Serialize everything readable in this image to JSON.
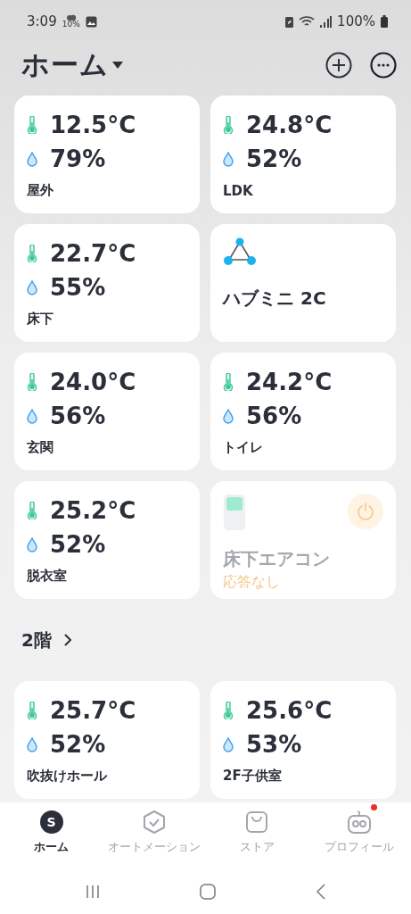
{
  "status_bar": {
    "time": "3:09",
    "weather_label": "10%",
    "battery": "100%"
  },
  "header": {
    "title": "ホーム"
  },
  "devices": [
    {
      "kind": "sensor",
      "temperature": "12.5°C",
      "humidity": "79%",
      "name": "屋外"
    },
    {
      "kind": "sensor",
      "temperature": "24.8°C",
      "humidity": "52%",
      "name": "LDK"
    },
    {
      "kind": "sensor",
      "temperature": "22.7°C",
      "humidity": "55%",
      "name": "床下"
    },
    {
      "kind": "hub",
      "name": "ハブミニ 2C"
    },
    {
      "kind": "sensor",
      "temperature": "24.0°C",
      "humidity": "56%",
      "name": "玄関"
    },
    {
      "kind": "sensor",
      "temperature": "24.2°C",
      "humidity": "56%",
      "name": "トイレ"
    },
    {
      "kind": "sensor",
      "temperature": "25.2°C",
      "humidity": "52%",
      "name": "脱衣室"
    },
    {
      "kind": "aircon",
      "name": "床下エアコン",
      "status": "応答なし",
      "online": false
    }
  ],
  "section": {
    "title": "2階"
  },
  "section_devices": [
    {
      "kind": "sensor",
      "temperature": "25.7°C",
      "humidity": "52%",
      "name": "吹抜けホール"
    },
    {
      "kind": "sensor",
      "temperature": "25.6°C",
      "humidity": "53%",
      "name": "2F子供室"
    }
  ],
  "tabs": [
    {
      "kind": "home",
      "label": "ホーム",
      "icon_letter": "S",
      "selected": true,
      "notification": false
    },
    {
      "kind": "automation",
      "label": "オートメーション",
      "selected": false,
      "notification": false
    },
    {
      "kind": "store",
      "label": "ストア",
      "selected": false,
      "notification": false
    },
    {
      "kind": "profile",
      "label": "プロフィール",
      "selected": false,
      "notification": true
    }
  ]
}
